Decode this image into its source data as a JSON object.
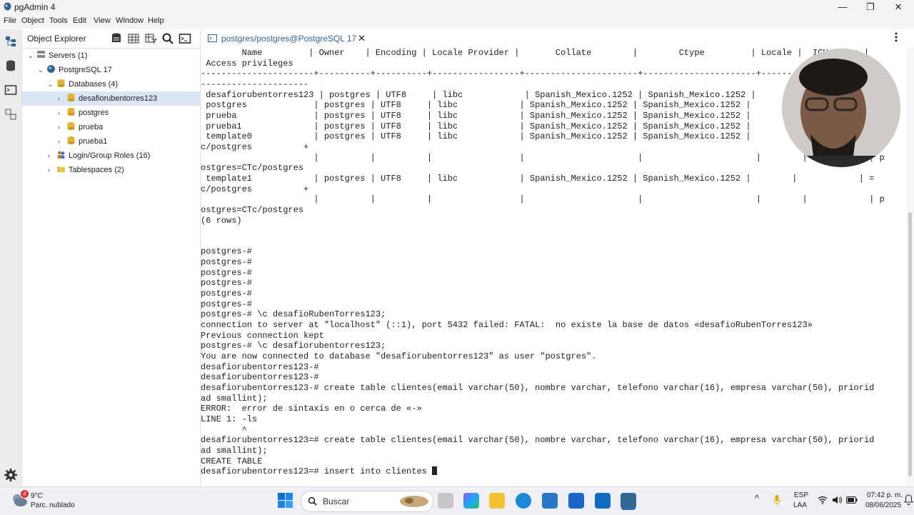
{
  "window": {
    "title": "pgAdmin 4",
    "minimize": "—",
    "maximize": "❐",
    "close": "✕"
  },
  "menu": {
    "file": "File",
    "object": "Object",
    "tools": "Tools",
    "edit": "Edit",
    "view": "View",
    "window": "Window",
    "help": "Help"
  },
  "explorer": {
    "title": "Object Explorer",
    "tree": {
      "servers": "Servers (1)",
      "server": "PostgreSQL 17",
      "databases": "Databases (4)",
      "db1": "desafiorubentorres123",
      "db2": "postgres",
      "db3": "prueba",
      "db4": "prueba1",
      "roles": "Login/Group Roles (16)",
      "tablespaces": "Tablespaces (2)"
    }
  },
  "tab": {
    "label": "postgres/postgres@PostgreSQL 17",
    "close": "✕"
  },
  "terminal": {
    "lines": [
      "        Name         | Owner    | Encoding | Locale Provider |       Collate        |        Ctype         | Locale |  ICU Rules |",
      " Access privileges",
      "----------------------+----------+----------+-----------------+----------------------+----------------------+--------+------------+",
      "---------------------",
      " desafiorubentorres123 | postgres | UTF8     | libc            | Spanish_Mexico.1252 | Spanish_Mexico.1252 |        |            |",
      " postgres             | postgres | UTF8     | libc            | Spanish_Mexico.1252 | Spanish_Mexico.1252 |        |            |",
      " prueba               | postgres | UTF8     | libc            | Spanish_Mexico.1252 | Spanish_Mexico.1252 |        |            |",
      " prueba1              | postgres | UTF8     | libc            | Spanish_Mexico.1252 | Spanish_Mexico.1252 |        |            |",
      " template0            | postgres | UTF8     | libc            | Spanish_Mexico.1252 | Spanish_Mexico.1252 |        |            | =",
      "c/postgres          +",
      "                      |          |          |                 |                      |                      |        |            | p",
      "ostgres=CTc/postgres",
      " template1            | postgres | UTF8     | libc            | Spanish_Mexico.1252 | Spanish_Mexico.1252 |        |            | =",
      "c/postgres          +",
      "                      |          |          |                 |                      |                      |        |            | p",
      "ostgres=CTc/postgres",
      "(6 rows)",
      "",
      "",
      "postgres-#",
      "postgres-#",
      "postgres-#",
      "postgres-#",
      "postgres-#",
      "postgres-#",
      "postgres-# \\c desafioRubenTorres123;",
      "connection to server at \"localhost\" (::1), port 5432 failed: FATAL:  no existe la base de datos «desafioRubenTorres123»",
      "Previous connection kept",
      "postgres-# \\c desafiorubentorres123;",
      "You are now connected to database \"desafiorubentorres123\" as user \"postgres\".",
      "desafiorubentorres123-#",
      "desafiorubentorres123-#",
      "desafiorubentorres123-# create table clientes(email varchar(50), nombre varchar, telefono varchar(16), empresa varchar(50), priorid",
      "ad smallint);",
      "ERROR:  error de sintaxis en o cerca de «-»",
      "LINE 1: -ls",
      "        ^",
      "desafiorubentorres123=# create table clientes(email varchar(50), nombre varchar, telefono varchar(16), empresa varchar(50), priorid",
      "ad smallint);",
      "CREATE TABLE"
    ],
    "prompt": "desafiorubentorres123=# ",
    "input": "insert into clientes "
  },
  "taskbar": {
    "temperature": "9°C",
    "weather": "Parc. nublado",
    "weather_badge": "4",
    "search_placeholder": "Buscar",
    "lang1": "ESP",
    "lang2": "LAA",
    "time": "07:42 p. m.",
    "date": "08/06/2025",
    "overflow": "^"
  },
  "colors": {
    "accent": "#326690",
    "selected": "#dbe6f5",
    "db_icon": "#e0b43c"
  }
}
